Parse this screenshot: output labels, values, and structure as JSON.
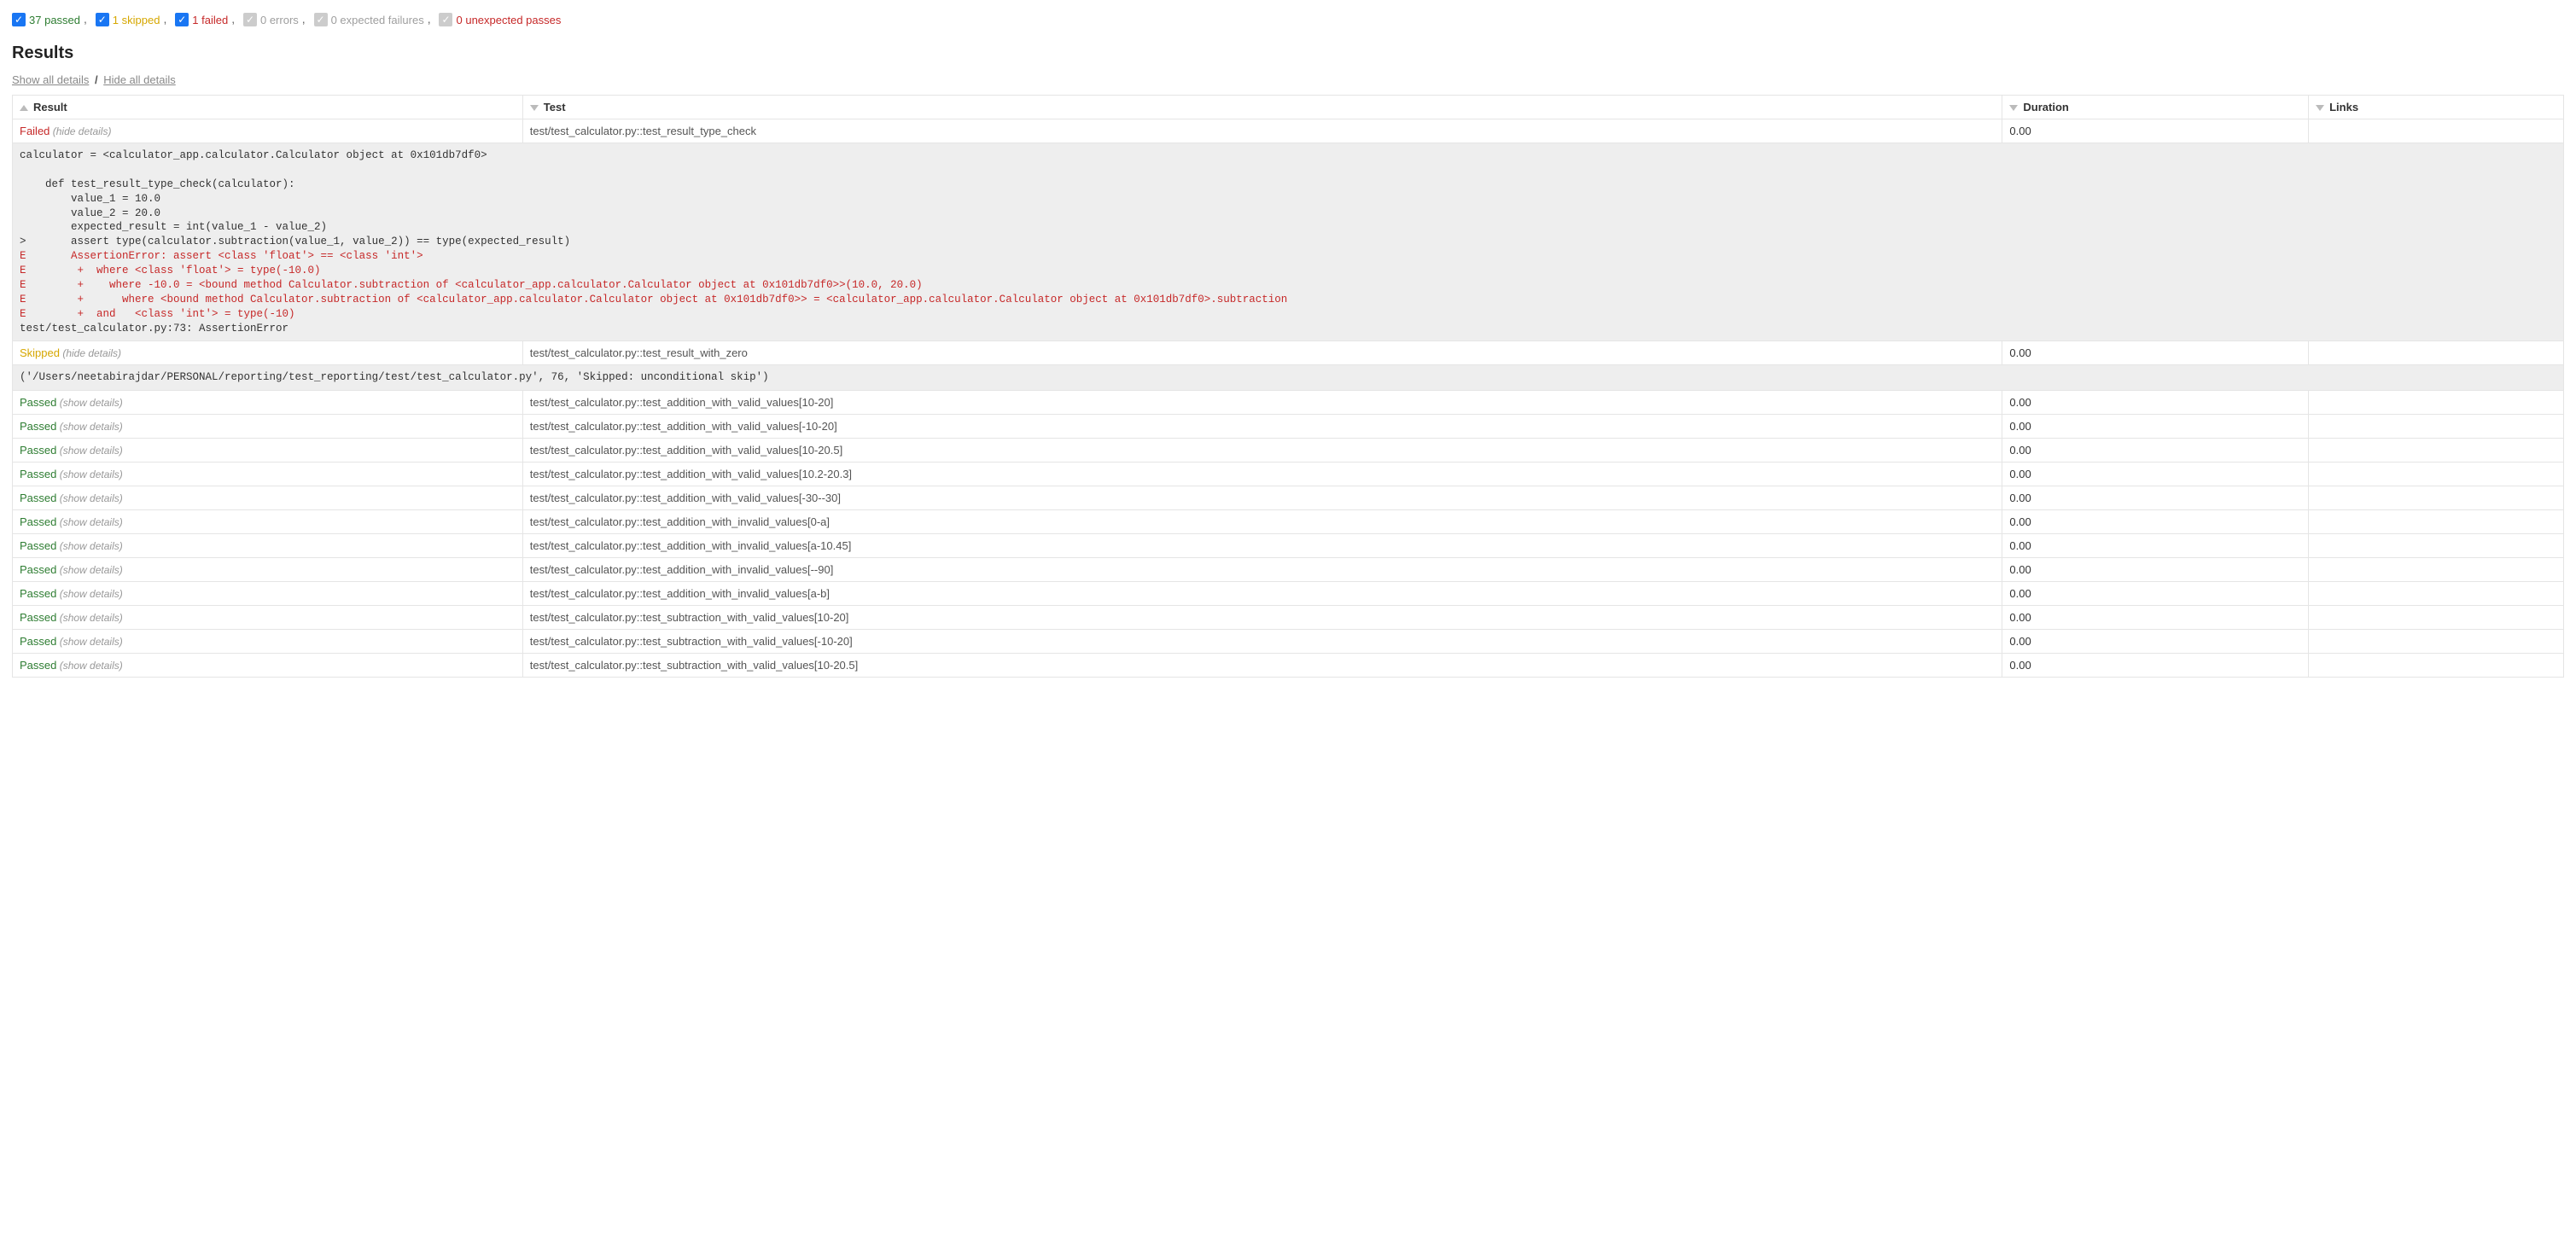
{
  "filters": {
    "passed": {
      "checked": true,
      "count": 37,
      "label": "passed",
      "cls": "lbl-passed"
    },
    "skipped": {
      "checked": true,
      "count": 1,
      "label": "skipped",
      "cls": "lbl-skipped"
    },
    "failed": {
      "checked": true,
      "count": 1,
      "label": "failed",
      "cls": "lbl-failed"
    },
    "errors": {
      "checked": false,
      "count": 0,
      "label": "errors",
      "cls": "lbl-errors"
    },
    "expfail": {
      "checked": false,
      "count": 0,
      "label": "expected failures",
      "cls": "lbl-expfail"
    },
    "unexp": {
      "checked": false,
      "count": 0,
      "label": "unexpected passes",
      "cls": "lbl-unexp"
    }
  },
  "headings": {
    "results": "Results",
    "show_all": "Show all details",
    "hide_all": "Hide all details"
  },
  "columns": {
    "result": "Result",
    "test": "Test",
    "duration": "Duration",
    "links": "Links"
  },
  "labels": {
    "hide_details": "(hide details)",
    "show_details": "(show details)"
  },
  "rows": [
    {
      "status": "Failed",
      "detail_mode": "hide",
      "test": "test/test_calculator.py::test_result_type_check",
      "duration": "0.00",
      "expanded": "failed"
    },
    {
      "status": "Skipped",
      "detail_mode": "hide",
      "test": "test/test_calculator.py::test_result_with_zero",
      "duration": "0.00",
      "expanded": "skipped"
    },
    {
      "status": "Passed",
      "detail_mode": "show",
      "test": "test/test_calculator.py::test_addition_with_valid_values[10-20]",
      "duration": "0.00"
    },
    {
      "status": "Passed",
      "detail_mode": "show",
      "test": "test/test_calculator.py::test_addition_with_valid_values[-10-20]",
      "duration": "0.00"
    },
    {
      "status": "Passed",
      "detail_mode": "show",
      "test": "test/test_calculator.py::test_addition_with_valid_values[10-20.5]",
      "duration": "0.00"
    },
    {
      "status": "Passed",
      "detail_mode": "show",
      "test": "test/test_calculator.py::test_addition_with_valid_values[10.2-20.3]",
      "duration": "0.00"
    },
    {
      "status": "Passed",
      "detail_mode": "show",
      "test": "test/test_calculator.py::test_addition_with_valid_values[-30--30]",
      "duration": "0.00"
    },
    {
      "status": "Passed",
      "detail_mode": "show",
      "test": "test/test_calculator.py::test_addition_with_invalid_values[0-a]",
      "duration": "0.00"
    },
    {
      "status": "Passed",
      "detail_mode": "show",
      "test": "test/test_calculator.py::test_addition_with_invalid_values[a-10.45]",
      "duration": "0.00"
    },
    {
      "status": "Passed",
      "detail_mode": "show",
      "test": "test/test_calculator.py::test_addition_with_invalid_values[--90]",
      "duration": "0.00"
    },
    {
      "status": "Passed",
      "detail_mode": "show",
      "test": "test/test_calculator.py::test_addition_with_invalid_values[a-b]",
      "duration": "0.00"
    },
    {
      "status": "Passed",
      "detail_mode": "show",
      "test": "test/test_calculator.py::test_subtraction_with_valid_values[10-20]",
      "duration": "0.00"
    },
    {
      "status": "Passed",
      "detail_mode": "show",
      "test": "test/test_calculator.py::test_subtraction_with_valid_values[-10-20]",
      "duration": "0.00"
    },
    {
      "status": "Passed",
      "detail_mode": "show",
      "test": "test/test_calculator.py::test_subtraction_with_valid_values[10-20.5]",
      "duration": "0.00"
    }
  ],
  "failed_details": {
    "plain_top": "calculator = <calculator_app.calculator.Calculator object at 0x101db7df0>\n\n    def test_result_type_check(calculator):\n        value_1 = 10.0\n        value_2 = 20.0\n        expected_result = int(value_1 - value_2)\n>       assert type(calculator.subtraction(value_1, value_2)) == type(expected_result)",
    "err_lines": "E       AssertionError: assert <class 'float'> == <class 'int'>\nE        +  where <class 'float'> = type(-10.0)\nE        +    where -10.0 = <bound method Calculator.subtraction of <calculator_app.calculator.Calculator object at 0x101db7df0>>(10.0, 20.0)\nE        +      where <bound method Calculator.subtraction of <calculator_app.calculator.Calculator object at 0x101db7df0>> = <calculator_app.calculator.Calculator object at 0x101db7df0>.subtraction\nE        +  and   <class 'int'> = type(-10)",
    "plain_bottom": "\ntest/test_calculator.py:73: AssertionError"
  },
  "skipped_details": "('/Users/neetabirajdar/PERSONAL/reporting/test_reporting/test/test_calculator.py', 76, 'Skipped: unconditional skip')"
}
